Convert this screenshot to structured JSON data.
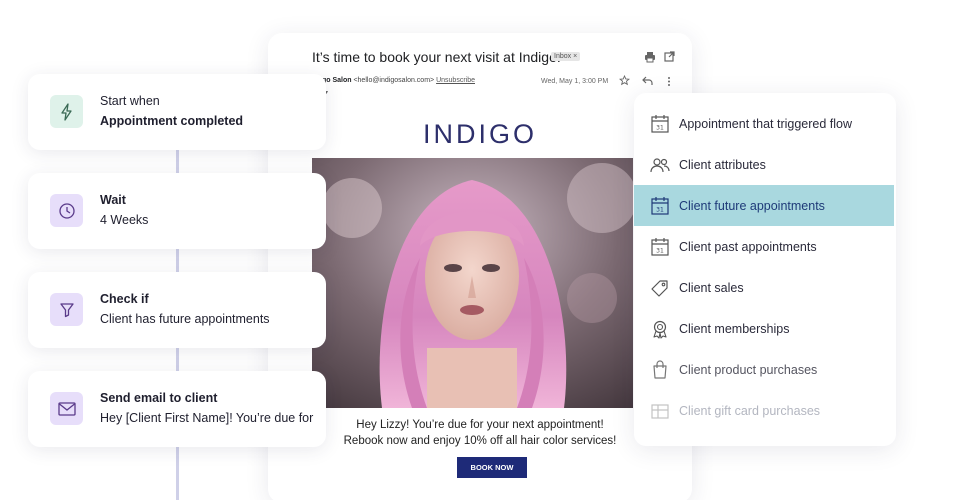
{
  "email": {
    "subject": "It’s time to book your next visit at Indigo!",
    "inbox_chip": "Inbox ×",
    "sender_name": "igo Salon",
    "sender_email": "<hello@indigosalon.com>",
    "unsubscribe": "Unsubscribe",
    "date": "Wed, May 1, 3:00 PM",
    "to_label": "e ▾",
    "brand": "INDIGO",
    "promo_line1": "Hey Lizzy! You’re due for your next appointment!",
    "promo_line2": "Rebook now and enjoy 10% off all hair color services!",
    "cta": "BOOK NOW",
    "icons": [
      "print-icon",
      "open-external-icon",
      "star-icon",
      "reply-icon",
      "more-vertical-icon"
    ]
  },
  "flow": {
    "steps": [
      {
        "title": "Start when",
        "subtitle": "Appointment completed",
        "icon": "lightning-icon",
        "icon_bg": "#dff2ea",
        "icon_color": "#3a6a55"
      },
      {
        "title": "Wait",
        "subtitle": "4 Weeks",
        "icon": "clock-icon",
        "icon_bg": "#e7defa",
        "icon_color": "#5a3a8a"
      },
      {
        "title": "Check if",
        "subtitle": "Client has future appointments",
        "icon": "filter-icon",
        "icon_bg": "#e7defa",
        "icon_color": "#5a3a8a"
      },
      {
        "title": "Send email to client",
        "subtitle": "Hey [Client First Name]! You’re due for",
        "icon": "envelope-icon",
        "icon_bg": "#e7defa",
        "icon_color": "#5a3a8a"
      }
    ]
  },
  "menu": {
    "active_color": "#a9d8df",
    "items": [
      {
        "label": "Appointment that triggered flow",
        "icon": "calendar-icon"
      },
      {
        "label": "Client attributes",
        "icon": "users-icon"
      },
      {
        "label": "Client future appointments",
        "icon": "calendar-icon",
        "active": true
      },
      {
        "label": "Client past appointments",
        "icon": "calendar-icon"
      },
      {
        "label": "Client sales",
        "icon": "tag-icon"
      },
      {
        "label": "Client memberships",
        "icon": "badge-icon"
      },
      {
        "label": "Client product purchases",
        "icon": "shopping-bag-icon"
      },
      {
        "label": "Client gift card purchases",
        "icon": "gift-card-icon"
      }
    ]
  }
}
